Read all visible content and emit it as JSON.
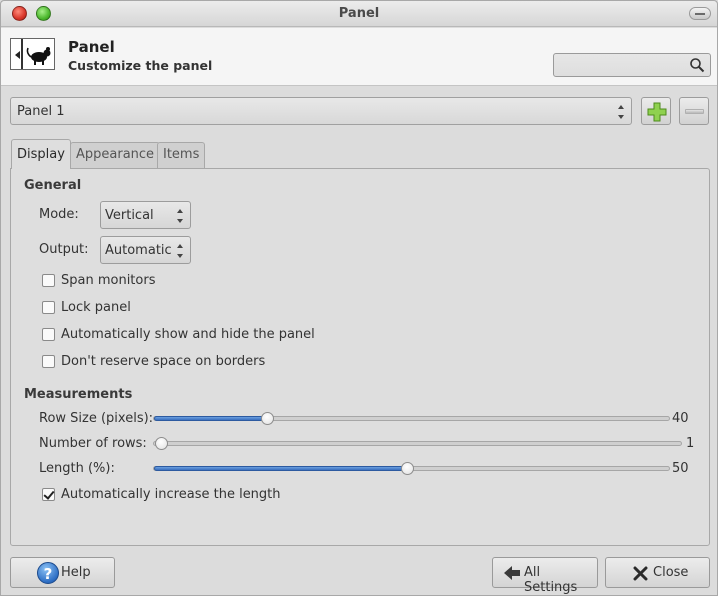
{
  "window": {
    "title": "Panel"
  },
  "header": {
    "title": "Panel",
    "subtitle": "Customize the panel",
    "search_placeholder": ""
  },
  "panel_selector": {
    "value": "Panel 1"
  },
  "tabs": [
    {
      "label": "Display",
      "active": true
    },
    {
      "label": "Appearance",
      "active": false
    },
    {
      "label": "Items",
      "active": false
    }
  ],
  "general": {
    "title": "General",
    "mode": {
      "label": "Mode:",
      "value": "Vertical"
    },
    "output": {
      "label": "Output:",
      "value": "Automatic"
    },
    "checkboxes": [
      {
        "label": "Span monitors",
        "checked": false
      },
      {
        "label": "Lock panel",
        "checked": false
      },
      {
        "label": "Automatically show and hide the panel",
        "checked": false
      },
      {
        "label": "Don't reserve space on borders",
        "checked": false
      }
    ]
  },
  "measurements": {
    "title": "Measurements",
    "row_size": {
      "label": "Row Size (pixels):",
      "value": "40"
    },
    "rows": {
      "label": "Number of rows:",
      "value": "1"
    },
    "length": {
      "label": "Length (%):",
      "value": "50"
    },
    "auto_increase": {
      "label": "Automatically increase the length",
      "checked": true
    }
  },
  "buttons": {
    "help": "Help",
    "all_settings": "All Settings",
    "close": "Close"
  }
}
